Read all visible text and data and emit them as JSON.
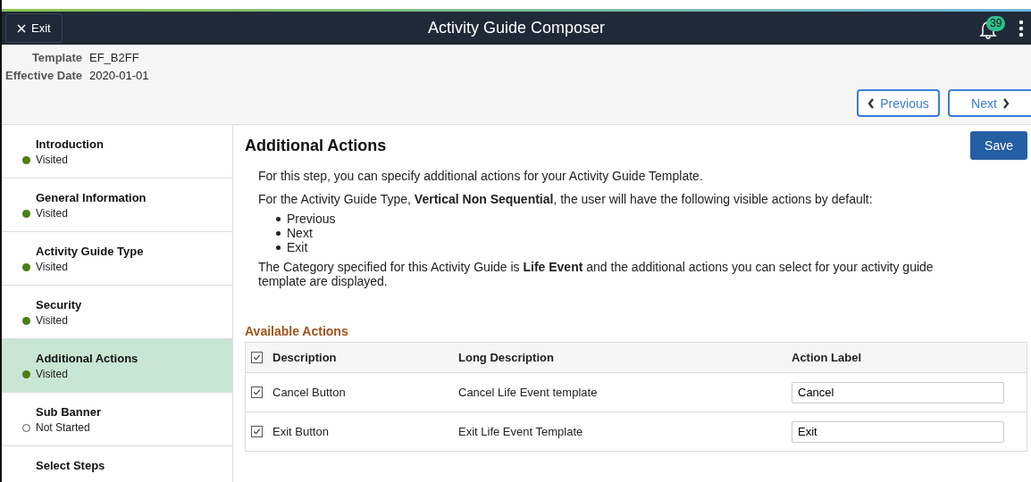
{
  "header": {
    "exit_label": "Exit",
    "title": "Activity Guide Composer",
    "notification_count": "39"
  },
  "info": [
    {
      "label": "Template",
      "value": "EF_B2FF"
    },
    {
      "label": "Effective Date",
      "value": "2020-01-01"
    }
  ],
  "nav_buttons": {
    "previous": "Previous",
    "next": "Next"
  },
  "steps": [
    {
      "title": "Introduction",
      "status": "Visited",
      "visited": true,
      "selected": false
    },
    {
      "title": "General Information",
      "status": "Visited",
      "visited": true,
      "selected": false
    },
    {
      "title": "Activity Guide Type",
      "status": "Visited",
      "visited": true,
      "selected": false
    },
    {
      "title": "Security",
      "status": "Visited",
      "visited": true,
      "selected": false
    },
    {
      "title": "Additional Actions",
      "status": "Visited",
      "visited": true,
      "selected": true
    },
    {
      "title": "Sub Banner",
      "status": "Not Started",
      "visited": false,
      "selected": false
    },
    {
      "title": "Select Steps",
      "selected": false
    }
  ],
  "content": {
    "title": "Additional Actions",
    "save_label": "Save",
    "intro": "For this step, you can specify additional actions for your Activity Guide Template.",
    "type_sentence": "For the Activity Guide Type, **Vertical Non Sequential**, the user will have the following visible actions by default:",
    "default_actions": [
      "Previous",
      "Next",
      "Exit"
    ],
    "category_sentence": "The Category specified for this Activity Guide is **Life Event** and the additional actions you can select for your activity guide template are displayed."
  },
  "available_actions": {
    "title": "Available Actions",
    "all_checked": true,
    "columns": [
      "Description",
      "Long Description",
      "Action Label"
    ],
    "rows": [
      {
        "checked": true,
        "description": "Cancel Button",
        "long_description": "Cancel Life Event template",
        "action_label": "Cancel"
      },
      {
        "checked": true,
        "description": "Exit Button",
        "long_description": "Exit Life Event Template",
        "action_label": "Exit"
      }
    ]
  }
}
